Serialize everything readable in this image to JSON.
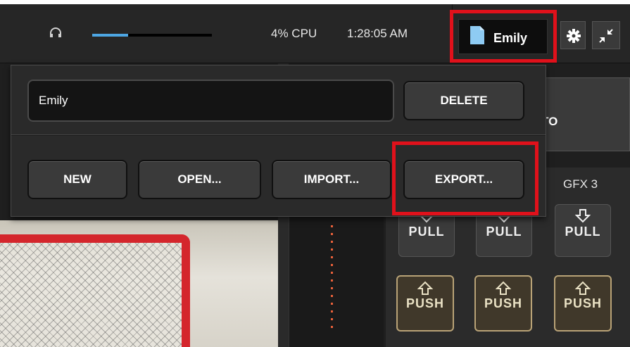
{
  "topbar": {
    "cpu": "4% CPU",
    "clock": "1:28:05 AM",
    "volume_level": 0.3,
    "profile_name": "Emily",
    "icons": [
      "headphones-icon",
      "document-icon",
      "gear-icon",
      "collapse-icon"
    ]
  },
  "menu": {
    "name_value": "Emily",
    "delete_label": "DELETE",
    "new_label": "NEW",
    "open_label": "OPEN...",
    "import_label": "IMPORT...",
    "export_label": "EXPORT..."
  },
  "right_panel": {
    "auto_partial": "TO",
    "gfx3_label": "GFX 3",
    "pull_label": "PULL",
    "push_label": "PUSH"
  },
  "colors": {
    "highlight": "#e0111b",
    "accent_blue": "#4da6e3",
    "push_border": "#b9a377",
    "dots": "#e8603a"
  }
}
